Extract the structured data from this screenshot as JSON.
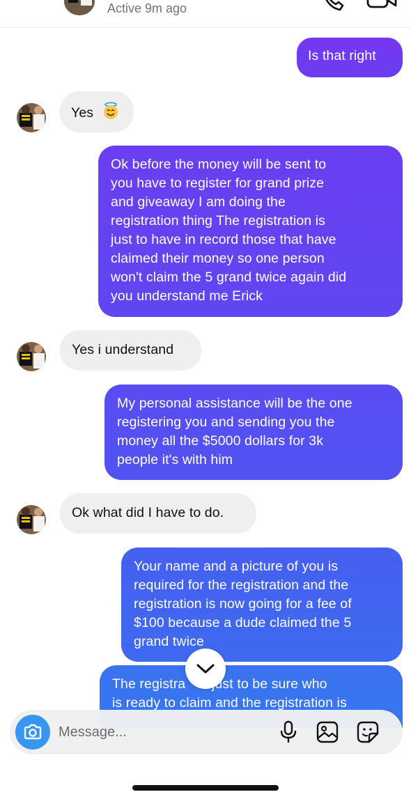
{
  "header": {
    "status": "Active 9m ago"
  },
  "messages": [
    {
      "direction": "outgoing",
      "text": "Is that right"
    },
    {
      "direction": "incoming",
      "text": "Yes",
      "emoji": "😇"
    },
    {
      "direction": "outgoing",
      "lines": [
        "Ok before the money will be sent to",
        "you have to register for grand prize",
        "and giveaway I am doing the",
        "registration thing The registration is",
        "just to have in record those that have",
        "claimed their money so one person",
        "won't claim the 5 grand twice again did",
        "you understand me Erick"
      ]
    },
    {
      "direction": "incoming",
      "text": "Yes i understand"
    },
    {
      "direction": "outgoing",
      "lines": [
        "My personal assistance will be the one",
        "registering you and sending you the",
        "money all the $5000 dollars for 3k",
        "people it's with him"
      ]
    },
    {
      "direction": "incoming",
      "text": "Ok what did I have to do."
    },
    {
      "direction": "outgoing",
      "lines": [
        "Your name and a picture of you is",
        "required for the registration and the",
        "registration is now going for a fee of",
        "$100  because a dude claimed the 5",
        "grand twice"
      ]
    },
    {
      "direction": "outgoing",
      "lines": [
        "The registra",
        "is just to be sure who",
        "is ready to claim and the registration is"
      ]
    }
  ],
  "composer": {
    "placeholder": "Message..."
  },
  "icons": {
    "back": "chevron-left-icon",
    "call": "phone-icon",
    "video": "video-camera-icon",
    "scroll": "chevron-down-icon",
    "camera": "camera-icon",
    "mic": "microphone-icon",
    "gallery": "image-icon",
    "sticker": "sticker-icon"
  },
  "colors": {
    "bubble_top": "#7a3ff2",
    "bubble_bottom": "#3d74f0",
    "incoming_bubble": "#efefef",
    "camera_button": "#3797f0"
  }
}
